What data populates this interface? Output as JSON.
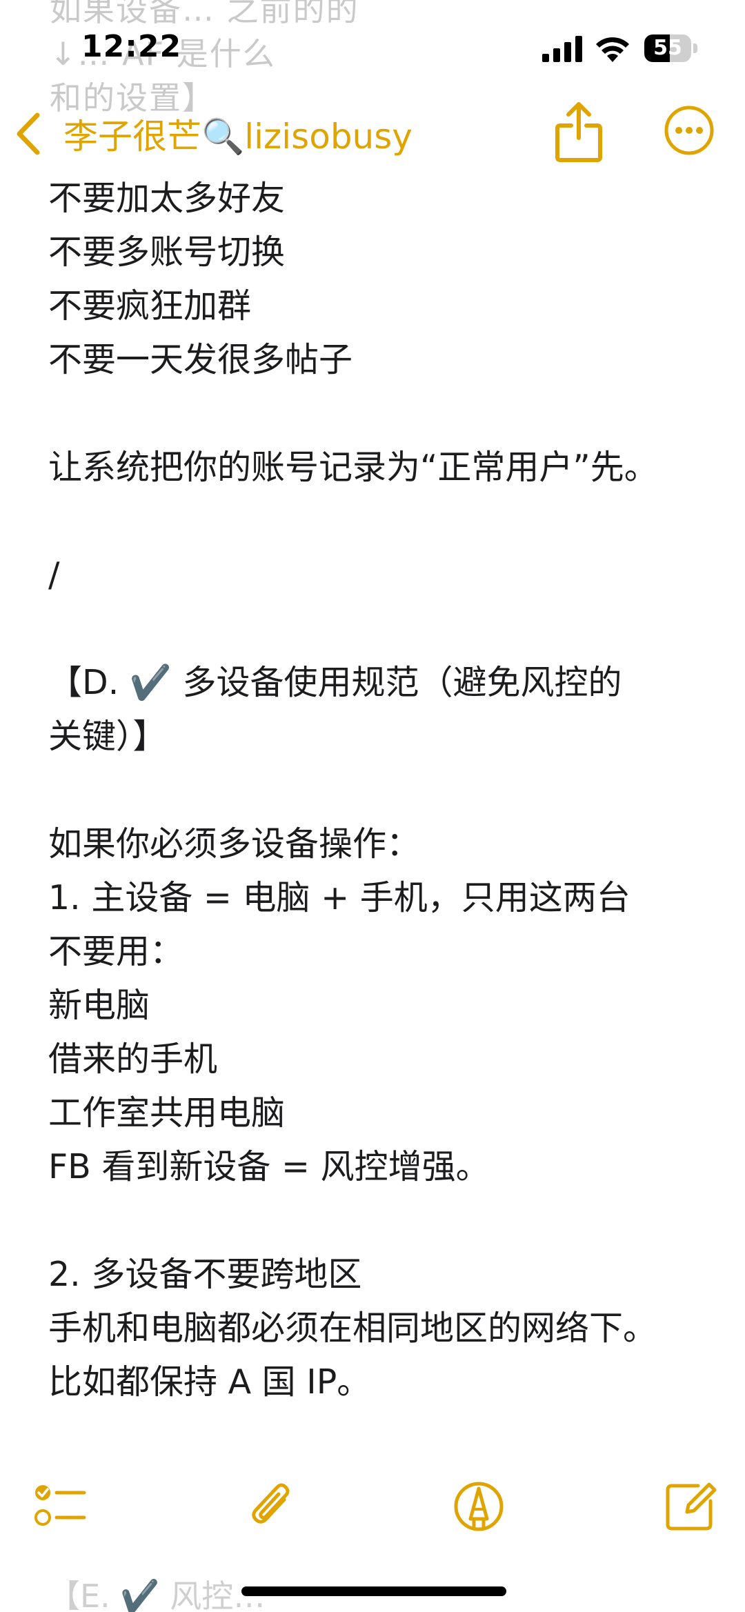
{
  "status_bar": {
    "time": "12:22",
    "battery_level": "55",
    "battery_fraction": 0.55,
    "faded_background_text": "如果设备… 之前的的\n↓… AF 是什么\n和的设置】"
  },
  "nav": {
    "back_label": "李子很芒🔍lizisobusy",
    "accent_color": "#E0A400",
    "share_icon": "share-icon",
    "more_icon": "more-icon"
  },
  "note": {
    "lines": [
      "不要加太多好友",
      "不要多账号切换",
      "不要疯狂加群",
      "不要一天发很多帖子",
      "",
      "让系统把你的账号记录为“正常用户”先。",
      "",
      "/",
      "",
      "【D. ✔️ 多设备使用规范（避免风控的",
      "关键）】",
      "",
      "如果你必须多设备操作：",
      "1. 主设备 = 电脑 + 手机，只用这两台",
      "不要用：",
      "新电脑",
      "借来的手机",
      "工作室共用电脑",
      "FB 看到新设备 = 风控增强。",
      "",
      "2. 多设备不要跨地区",
      "手机和电脑都必须在相同地区的网络下。",
      "比如都保持 A 国 IP。"
    ]
  },
  "toolbar": {
    "checklist_icon": "checklist-icon",
    "attach_icon": "paperclip-icon",
    "markup_icon": "markup-pen-icon",
    "compose_icon": "compose-icon"
  },
  "bottom_faded_text": "【E. ✔️ 风控…"
}
